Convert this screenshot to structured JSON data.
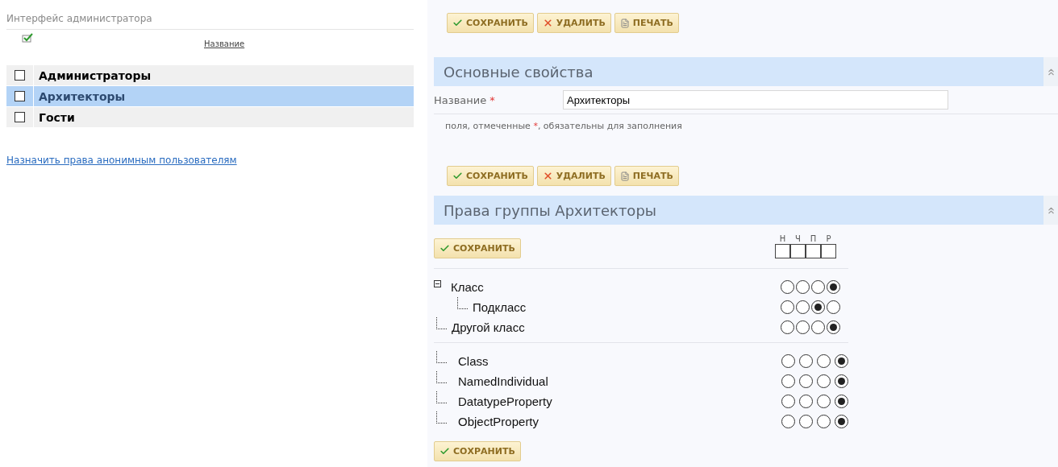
{
  "sidebar": {
    "title": "Интерфейс администратора",
    "column": "Название",
    "groups": [
      {
        "name": "Администраторы",
        "checked": false,
        "selected": false
      },
      {
        "name": "Архитекторы",
        "checked": false,
        "selected": true
      },
      {
        "name": "Гости",
        "checked": false,
        "selected": false
      }
    ],
    "link": "Назначить права анонимным пользователям"
  },
  "toolbar": [
    {
      "kind": "save",
      "label": "СОХРАНИТЬ"
    },
    {
      "kind": "delete",
      "label": "УДАЛИТЬ"
    },
    {
      "kind": "print",
      "label": "ПЕЧАТЬ"
    }
  ],
  "properties": {
    "title": "Основные свойства",
    "field": {
      "label": "Название",
      "required": true,
      "value": "Архитекторы"
    },
    "note": {
      "text": "поля, отмеченные ",
      "mark": "*",
      "text_end": ", обязательны для заполнения"
    }
  },
  "toolbar_2": [
    {
      "kind": "save",
      "label": "СОХРАНИТЬ"
    },
    {
      "kind": "delete",
      "label": "УДАЛИТЬ"
    },
    {
      "kind": "print",
      "label": "ПЕЧАТЬ"
    }
  ],
  "rights": {
    "title": "Права группы Архитекторы",
    "save_top": "СОХРАНИТЬ",
    "columns": [
      {
        "label": "Н",
        "checked": false
      },
      {
        "label": "Ч",
        "checked": false
      },
      {
        "label": "П",
        "checked": false
      },
      {
        "label": "Р",
        "checked": false
      }
    ],
    "sections": [
      {
        "spaced": false,
        "items": [
          {
            "name": "Класс",
            "expanded": true,
            "radios": [
              {
                "selected": false
              },
              {
                "selected": false
              },
              {
                "selected": false
              },
              {
                "selected": true
              }
            ],
            "children": [
              {
                "name": "Подкласс",
                "radios": [
                  {
                    "selected": false
                  },
                  {
                    "selected": false
                  },
                  {
                    "selected": true
                  },
                  {
                    "selected": false
                  }
                ]
              }
            ]
          },
          {
            "name": "Другой класс",
            "radios": [
              {
                "selected": false
              },
              {
                "selected": false
              },
              {
                "selected": false
              },
              {
                "selected": true
              }
            ]
          }
        ]
      },
      {
        "spaced": true,
        "items": [
          {
            "name": "Class",
            "radios": [
              {
                "selected": false
              },
              {
                "selected": false
              },
              {
                "selected": false
              },
              {
                "selected": true
              }
            ]
          },
          {
            "name": "NamedIndividual",
            "radios": [
              {
                "selected": false
              },
              {
                "selected": false
              },
              {
                "selected": false
              },
              {
                "selected": true
              }
            ]
          },
          {
            "name": "DatatypeProperty",
            "radios": [
              {
                "selected": false
              },
              {
                "selected": false
              },
              {
                "selected": false
              },
              {
                "selected": true
              }
            ]
          },
          {
            "name": "ObjectProperty",
            "radios": [
              {
                "selected": false
              },
              {
                "selected": false
              },
              {
                "selected": false
              },
              {
                "selected": true
              }
            ]
          }
        ]
      }
    ],
    "save_bottom": "СОХРАНИТЬ"
  }
}
